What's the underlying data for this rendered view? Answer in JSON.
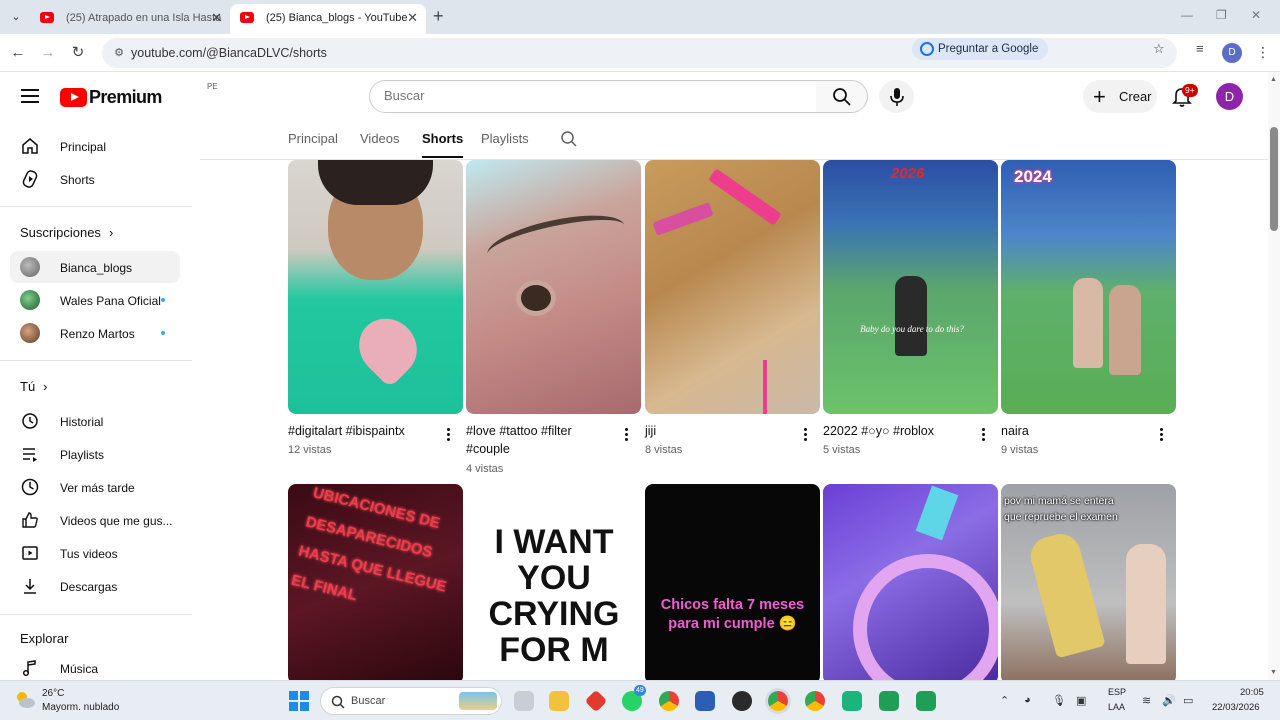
{
  "browser": {
    "tabs": [
      {
        "title": "(25) Atrapado en una Isla Hasta"
      },
      {
        "title": "(25) Bianca_blogs - YouTube"
      }
    ],
    "url": "youtube.com/@BiancaDLVC/shorts",
    "ask_google": "Preguntar a Google",
    "profile_initial": "D"
  },
  "header": {
    "logo_word": "Premium",
    "country": "PE",
    "search_placeholder": "Buscar",
    "create_label": "Crear",
    "notif_badge": "9+",
    "avatar_initial": "D"
  },
  "sidebar": {
    "main": [
      {
        "label": "Principal",
        "icon": "home-icon"
      },
      {
        "label": "Shorts",
        "icon": "shorts-icon"
      }
    ],
    "subs_heading": "Suscripciones",
    "subs": [
      {
        "label": "Bianca_blogs",
        "new": false
      },
      {
        "label": "Wales Pana Oficial",
        "new": true
      },
      {
        "label": "Renzo Martos",
        "new": true
      }
    ],
    "you_heading": "Tú",
    "you": [
      {
        "label": "Historial",
        "icon": "history-icon"
      },
      {
        "label": "Playlists",
        "icon": "playlists-icon"
      },
      {
        "label": "Ver más tarde",
        "icon": "watch-later-icon"
      },
      {
        "label": "Videos que me gus...",
        "icon": "liked-icon"
      },
      {
        "label": "Tus videos",
        "icon": "your-videos-icon"
      },
      {
        "label": "Descargas",
        "icon": "downloads-icon"
      }
    ],
    "explore_heading": "Explorar",
    "explore": [
      {
        "label": "Música",
        "icon": "music-icon"
      }
    ]
  },
  "channel_tabs": [
    {
      "label": "Principal",
      "active": false
    },
    {
      "label": "Videos",
      "active": false
    },
    {
      "label": "Shorts",
      "active": true
    },
    {
      "label": "Playlists",
      "active": false
    }
  ],
  "shorts_row1": [
    {
      "title": "#digitalart #ibispaintx",
      "views": "12 vistas",
      "overlay": ""
    },
    {
      "title": "#love #tattoo #filter #couple",
      "views": "4 vistas",
      "overlay": ""
    },
    {
      "title": "jiji",
      "views": "8 vistas",
      "overlay": ""
    },
    {
      "title": "22022 #○y○ #roblox",
      "views": "5 vistas",
      "overlay": "2026"
    },
    {
      "title": "naira",
      "views": "9 vistas",
      "overlay": "2024"
    }
  ],
  "shorts_row2": [
    {
      "overlay": "UBICACIONES DE DESAPARECIDOS HASTA QUE LLEGUE EL FINAL"
    },
    {
      "overlay": "I WANT YOU CRYING FOR M"
    },
    {
      "overlay": "Chicos falta 7 meses para mi cumple 😑"
    },
    {
      "overlay": ""
    },
    {
      "overlay": "pov mi mamá se entera que repruebe el examen"
    }
  ],
  "thumb4_caption": "Baby do you dare to do this?",
  "taskbar": {
    "temperature": "26°C",
    "condition": "Mayorm. nublado",
    "search_label": "Buscar",
    "whatsapp_count": "49",
    "lang_1": "ESP",
    "lang_2": "LAA",
    "time": "20:05",
    "date": "22/03/2026"
  }
}
